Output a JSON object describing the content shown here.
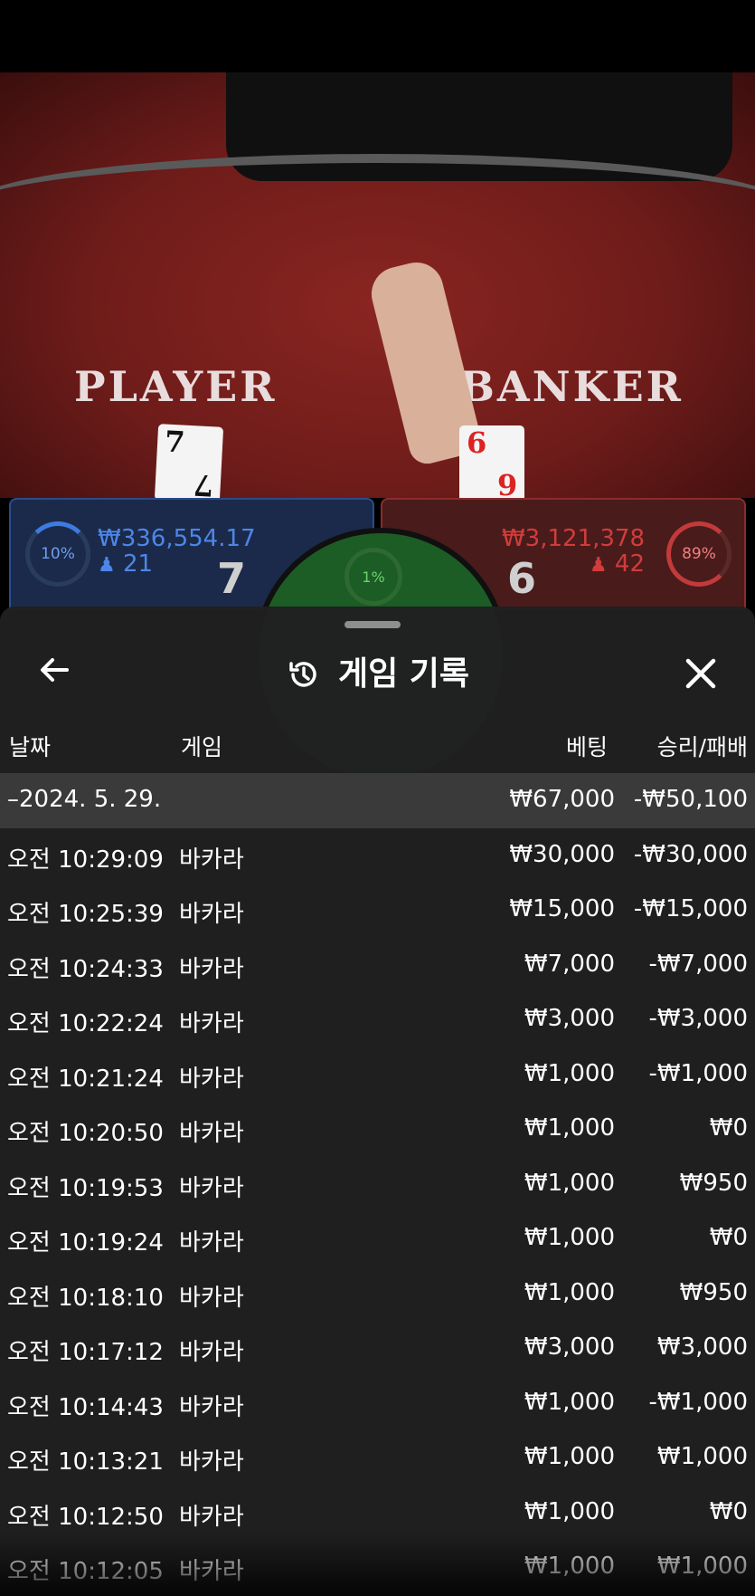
{
  "table": {
    "player_label": "PLAYER",
    "banker_label": "BANKER",
    "player_card": "7",
    "banker_card": "6",
    "player": {
      "percent": "10%",
      "amount": "₩336,554.17",
      "players": "21",
      "score": "7"
    },
    "banker": {
      "percent": "89%",
      "amount": "₩3,121,378",
      "players": "42",
      "score": "6"
    },
    "tie": {
      "percent": "1%"
    }
  },
  "sheet": {
    "title": "게임 기록",
    "back_icon": "arrow-left-icon",
    "history_icon": "history-icon",
    "close_icon": "close-icon"
  },
  "columns": {
    "date": "날짜",
    "game": "게임",
    "bet": "베팅",
    "result": "승리/패배"
  },
  "date_group": {
    "date": "–2024. 5. 29.",
    "bet": "₩67,000",
    "result": "-₩50,100"
  },
  "rows": [
    {
      "time": "오전 10:29:09",
      "game": "바카라",
      "bet": "₩30,000",
      "result": "-₩30,000"
    },
    {
      "time": "오전 10:25:39",
      "game": "바카라",
      "bet": "₩15,000",
      "result": "-₩15,000"
    },
    {
      "time": "오전 10:24:33",
      "game": "바카라",
      "bet": "₩7,000",
      "result": "-₩7,000"
    },
    {
      "time": "오전 10:22:24",
      "game": "바카라",
      "bet": "₩3,000",
      "result": "-₩3,000"
    },
    {
      "time": "오전 10:21:24",
      "game": "바카라",
      "bet": "₩1,000",
      "result": "-₩1,000"
    },
    {
      "time": "오전 10:20:50",
      "game": "바카라",
      "bet": "₩1,000",
      "result": "₩0"
    },
    {
      "time": "오전 10:19:53",
      "game": "바카라",
      "bet": "₩1,000",
      "result": "₩950"
    },
    {
      "time": "오전 10:19:24",
      "game": "바카라",
      "bet": "₩1,000",
      "result": "₩0"
    },
    {
      "time": "오전 10:18:10",
      "game": "바카라",
      "bet": "₩1,000",
      "result": "₩950"
    },
    {
      "time": "오전 10:17:12",
      "game": "바카라",
      "bet": "₩3,000",
      "result": "₩3,000"
    },
    {
      "time": "오전 10:14:43",
      "game": "바카라",
      "bet": "₩1,000",
      "result": "-₩1,000"
    },
    {
      "time": "오전 10:13:21",
      "game": "바카라",
      "bet": "₩1,000",
      "result": "₩1,000"
    },
    {
      "time": "오전 10:12:50",
      "game": "바카라",
      "bet": "₩1,000",
      "result": "₩0"
    },
    {
      "time": "오전 10:12:05",
      "game": "바카라",
      "bet": "₩1,000",
      "result": "₩1,000"
    }
  ]
}
